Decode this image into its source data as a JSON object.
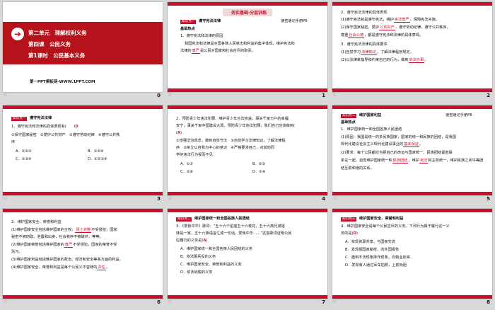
{
  "slides": [
    {
      "number": "0",
      "unit_title": "第二单元　理解权利义务",
      "lesson_title": "第四课　公民义务",
      "section_title": "第1课时　公民基本义务",
      "footer_site": "第一PPT模板网-WWW.1PPT.COM"
    },
    {
      "number": "1",
      "banner": "务实基础·分层训练",
      "tag": "知识点一",
      "heading": "遵守宪法法律",
      "ref": "速查速记手册P8",
      "sub": "基础热点",
      "q1": "1．遵守宪法和法律的原因",
      "line1": "我国宪法和法律是全国各族人民意志和利益的集中体现，维护宪法和",
      "line2a": "法律的",
      "line2_ans": "尊严",
      "line2b": "是公民对国家和社会应尽的职责。"
    },
    {
      "number": "2",
      "q": "2．遵守宪法法律的具体表现",
      "l1a": "(1)遵守宪法就是遵守宪法，维护",
      "l1_ans": "宪法尊严",
      "l1b": "，保障宪法实施。",
      "l2a": "(2)保守国家秘密，爱护",
      "l2_ans": "公共财产",
      "l2b": "，遵守劳动纪律，遵守公共秩序，",
      "l3a": "尊重",
      "l3_ans": "社会公德",
      "l3b": "，都是遵守宪法和法律的具体表现。",
      "q3": "3．遵守宪法法律的具体要求",
      "l4a": "(1)自觉学习",
      "l4_ans": "法律知识",
      "l4b": "，了解法律程序规定。",
      "l5a": "(2)以法律来指导和约束自己的行为，做到",
      "l5_ans": "依法办事",
      "l5b": "。"
    },
    {
      "number": "3",
      "tag": "知识点一",
      "heading": "遵守宪法法律",
      "q": "1．遵守宪法和法律的具体表现有(　　)",
      "answer": "D",
      "opt_line1": "①保守国家秘密　②爱护公共财产　③遵守劳动纪律　④遵守公共秩",
      "opt_line2": "序",
      "optA": "A．①②③",
      "optB": "B．①②④",
      "optC": "C．②③④",
      "optD": "D．①②③④"
    },
    {
      "number": "4",
      "q_line1": "2．预防青少年违法犯罪、维护青少年合法权益，事关千家万户的幸福",
      "q_line2": "安宁，事关千家中国建设大局。预防青少年违法犯罪，我们自己应该做到(",
      "answer": "A",
      "a_line1": "①增强法治观念，做到自觉守法　②自觉学习法律知识，了解法律程",
      "a_line2": "序　③树立以自我为中心的意识　④严格要求自己，对其他同",
      "a_line3": "学的违法行为视而不见",
      "optA": "A．①②",
      "optB": "B．②③",
      "optC": "C．②④",
      "optD": "D．①④"
    },
    {
      "number": "5",
      "tag": "知识点二",
      "heading": "维护国家利益",
      "ref": "速查速记手册P8",
      "sub": "基础热点",
      "q1": "1．维护国家统一和全国各族人民团结",
      "l1": "(1)原因：我国是统一的多民族国家，国家的统一和民族的团结，是我国",
      "l2a": "现代化建设社会主义现代化建设事业的",
      "l2_ans": "基本保证",
      "l2b": "。",
      "l3": "(2)要求：每个公民都应当把自己的命运与国家统一、民族团结紧密联",
      "l4a": "系在一起，自觉维护国家统一和",
      "l4_ans": "民族团结",
      "l4b": "，维护",
      "l4_ans2": "宪法",
      "l4c": "和主权统一，维护民族之间平等团",
      "l5": "结互助和谐的关系。"
    },
    {
      "number": "6",
      "q": "2．维护国家安全、荣誉和利益",
      "l1a": "(1)维护国家安全包括维护国家的主权、",
      "l1_ans": "领土完整",
      "l1b": "不受侵犯，国家",
      "l2": "秘密不被窃取、泄露和出卖，社会秩序不被破坏，等等。",
      "l3a": "(2)维护国家荣誉包括维护国家的",
      "l3_ans": "尊严",
      "l3b": "不受侵犯，国家的荣誉不受",
      "l4": "玷污。",
      "l5": "(3)维护国家利益包括维护国家的政治、经济和安全等各方面的利益。",
      "l6a": "(4)维护国家安全、荣誉和利益是每个公民义不容辞的",
      "l6_ans": "责任",
      "l6b": "。"
    },
    {
      "number": "7",
      "tag": "知识点二",
      "heading": "维护国家统一和全国各族人民团结",
      "q_line1": "3．《爱我中华》歌词：“五十六个星座五十六枝花，五十六族兄弟姐",
      "q_line2": "妹是一家，五十六族语言汇成一句话，爱我中华……”这首歌词证明公民",
      "q_line3": "应履行的义务是(",
      "answer": "A",
      "optA": "A．维护国家统一和全国各族人民团结的义务",
      "optB": "B．依法服兵役的义务",
      "optC": "C．维护国家安全、荣誉和利益的义务",
      "optD": "D．依法纳税的义务"
    },
    {
      "number": "8",
      "tag": "知识点三",
      "heading": "维护国家安全、荣誉和利益",
      "q_line1": "4．维护国家安全是每个公民应尽的义务。下列行为属于履行这一义",
      "q_line2": "务的是(",
      "answer": "D",
      "optA": "A．实现资源共享，与国家交流",
      "optB": "B．发现报国家秘密，向外国报告",
      "optC": "C．遇到不法现象择作现象，向物业反映",
      "optD": "D．发现有人通过军车拍照，上前劝阻"
    }
  ]
}
